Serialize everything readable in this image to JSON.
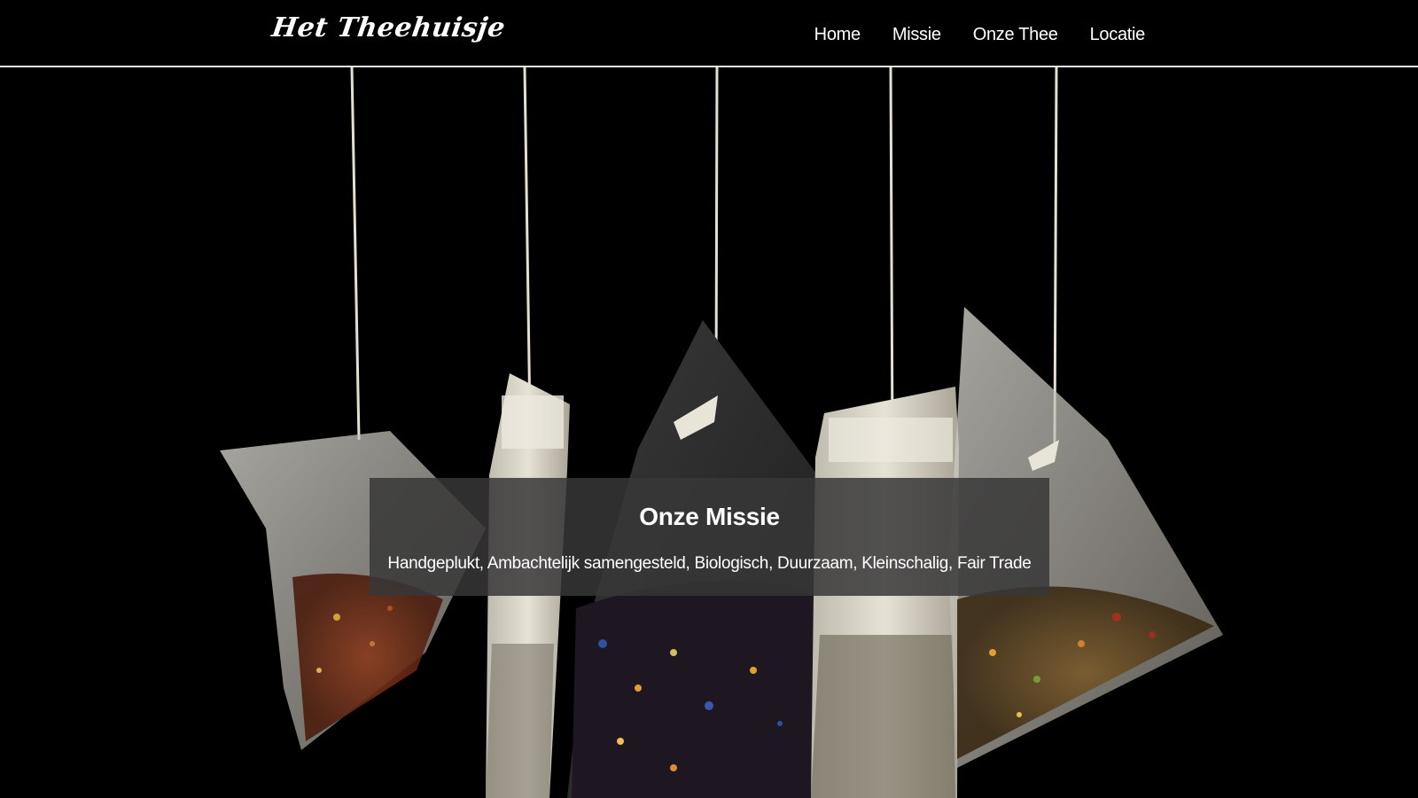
{
  "header": {
    "logo_text": "Het Theehuisje",
    "nav": [
      {
        "label": "Home"
      },
      {
        "label": "Missie"
      },
      {
        "label": "Onze Thee"
      },
      {
        "label": "Locatie"
      }
    ]
  },
  "hero": {
    "image": "tea-bags-hanging-photo",
    "background_color": "#000000"
  },
  "mission": {
    "title": "Onze Missie",
    "text": "Handgeplukt, Ambachtelijk samengesteld, Biologisch, Duurzaam, Kleinschalig, Fair Trade",
    "overlay_color": "#373737"
  }
}
